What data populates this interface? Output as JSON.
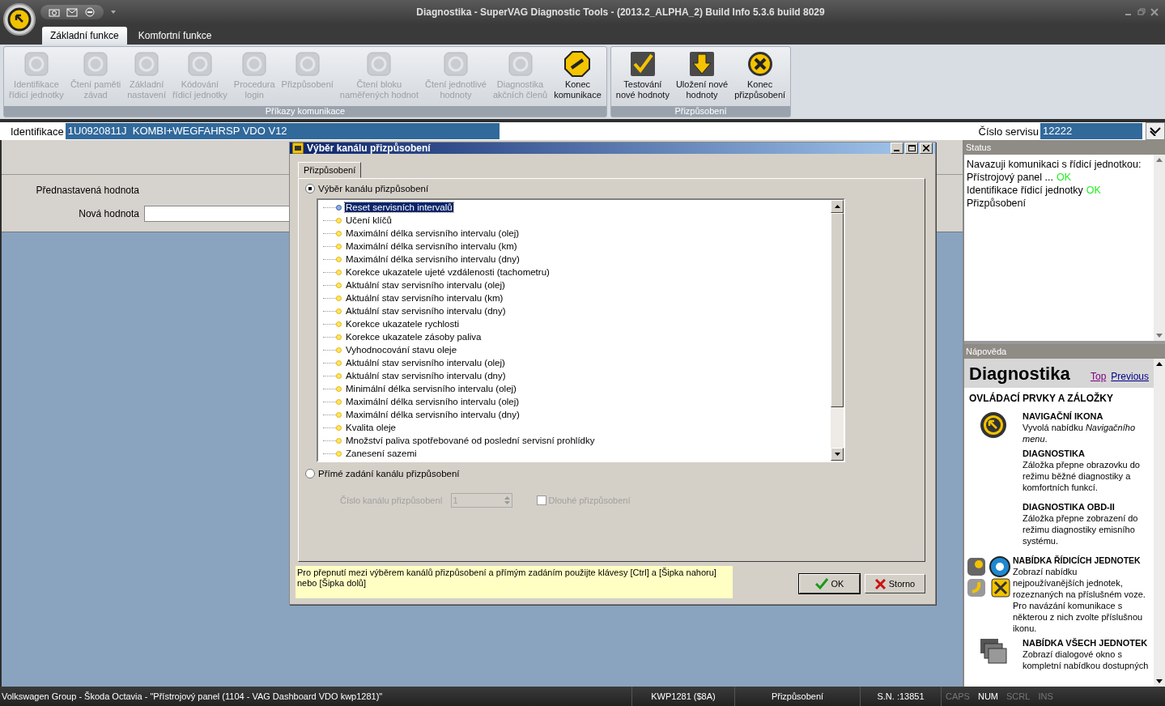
{
  "window": {
    "title": "Diagnostika - SuperVAG Diagnostic Tools -  (2013.2_ALPHA_2) Build Info 5.3.6 build 8029"
  },
  "ribbon_tabs": [
    {
      "label": "Základní funkce",
      "selected": true
    },
    {
      "label": "Komfortní funkce",
      "selected": false
    }
  ],
  "ribbon_groups": [
    {
      "label": "Příkazy komunikace",
      "buttons": [
        {
          "label": "Identifikace\nřídicí jednotky",
          "disabled": true
        },
        {
          "label": "Čtení paměti\nzávad",
          "disabled": true
        },
        {
          "label": "Základní\nnastavení",
          "disabled": true
        },
        {
          "label": "Kódování\nřídicí jednotky",
          "disabled": true
        },
        {
          "label": "Procedura\nlogin",
          "disabled": true
        },
        {
          "label": "Přizpůsobení",
          "disabled": true
        },
        {
          "label": "Čtení bloku\nnaměřených hodnot",
          "disabled": true
        },
        {
          "label": "Čtení jednotlivé\nhodnoty",
          "disabled": true
        },
        {
          "label": "Diagnostika\nakčních členů",
          "disabled": true
        },
        {
          "label": "Konec\nkomunikace",
          "disabled": false
        }
      ]
    },
    {
      "label": "Přizpůsobení",
      "buttons": [
        {
          "label": "Testování\nnové hodnoty",
          "disabled": false
        },
        {
          "label": "Uložení nové\nhodnoty",
          "disabled": false
        },
        {
          "label": "Konec\npřizpůsobení",
          "disabled": false
        }
      ]
    }
  ],
  "info_bar": {
    "fields": [
      {
        "label": "Identifikace",
        "value": "1U0920811J  KOMBI+WEGFAHRSP VDO V12"
      },
      {
        "label": "Číslo servisu",
        "value": "12222"
      }
    ]
  },
  "value_panel": {
    "preset_label": "Přednastavená hodnota",
    "new_label": "Nová hodnota"
  },
  "dialog": {
    "title": "Výběr kanálu přizpůsobení",
    "tab": "Přizpůsobení",
    "list_radio": {
      "label": "Výběr kanálu přizpůsobení",
      "selected": true
    },
    "channels": [
      {
        "label": "Reset servisních intervalů",
        "selected": true
      },
      {
        "label": "Učení klíčů",
        "selected": false
      },
      {
        "label": "Maximální délka servisního intervalu (olej)",
        "selected": false
      },
      {
        "label": "Maximální délka servisního intervalu (km)",
        "selected": false
      },
      {
        "label": "Maximální délka servisního intervalu (dny)",
        "selected": false
      },
      {
        "label": "Korekce ukazatele ujeté vzdálenosti (tachometru)",
        "selected": false
      },
      {
        "label": "Aktuální stav servisního intervalu (olej)",
        "selected": false
      },
      {
        "label": "Aktuální stav servisního intervalu (km)",
        "selected": false
      },
      {
        "label": "Aktuální stav servisního intervalu (dny)",
        "selected": false
      },
      {
        "label": "Korekce ukazatele rychlosti",
        "selected": false
      },
      {
        "label": "Korekce ukazatele zásoby paliva",
        "selected": false
      },
      {
        "label": "Vyhodnocování stavu oleje",
        "selected": false
      },
      {
        "label": "Aktuální stav servisního intervalu (olej)",
        "selected": false
      },
      {
        "label": "Aktuální stav servisního intervalu (dny)",
        "selected": false
      },
      {
        "label": "Minimální délka servisního intervalu (olej)",
        "selected": false
      },
      {
        "label": "Maximální délka servisního intervalu (olej)",
        "selected": false
      },
      {
        "label": "Maximální délka servisního intervalu (dny)",
        "selected": false
      },
      {
        "label": "Kvalita oleje",
        "selected": false
      },
      {
        "label": "Množství paliva spotřebované od poslední servisní prohlídky",
        "selected": false
      },
      {
        "label": "Zanesení sazemi",
        "selected": false
      }
    ],
    "direct_radio": {
      "label": "Přímé zadání kanálu přizpůsobení",
      "selected": false
    },
    "channel_number": {
      "label": "Číslo kanálu přizpůsobení",
      "value": "1",
      "disabled": true
    },
    "long_checkbox": {
      "label": "Dlouhé přizpůsobení",
      "checked": false,
      "disabled": true
    },
    "hint": "Pro přepnutí mezi výběrem kanálů přizpůsobení a přímým zadáním použijte klávesy [Ctrl] a [Šipka nahoru] nebo [Šipka dolů]",
    "buttons": [
      {
        "label": "OK",
        "kind": "ok"
      },
      {
        "label": "Storno",
        "kind": "cancel"
      }
    ]
  },
  "status_panel": {
    "title": "Status",
    "lines": [
      {
        "text": "Navazuji komunikaci s řídicí jednotkou:"
      },
      {
        "text": "Přístrojový panel ...",
        "result": "OK"
      },
      {
        "text": "Identifikace řídicí jednotky",
        "result": "OK"
      },
      {
        "text": "Přizpůsobení"
      }
    ]
  },
  "help_panel": {
    "title": "Nápověda",
    "heading": "Diagnostika",
    "links": [
      {
        "label": "Top",
        "visited": true
      },
      {
        "label": "Previous",
        "visited": false
      }
    ],
    "subtitle": "OVLÁDACÍ PRVKY A ZÁLOŽKY",
    "entries": [
      {
        "title": "NAVIGAČNÍ IKONA",
        "text": "Vyvolá nabídku *Navigačního menu*."
      },
      {
        "title": "DIAGNOSTIKA",
        "text": "Záložka přepne obrazovku do režimu běžné diagnostiky a komfortních funkcí."
      },
      {
        "title": "DIAGNOSTIKA OBD-II",
        "text": "Záložka přepne zobrazení do režimu diagnostiky emisního systému."
      },
      {
        "title": "NABÍDKA ŘÍDICÍCH JEDNOTEK",
        "text": "Zobrazí nabídku nejpoužívanějších jednotek, rozeznaných na příslušném voze. Pro navázání komunikace s některou z nich zvolte příslušnou ikonu."
      },
      {
        "title": "NABÍDKA VŠECH JEDNOTEK",
        "text": "Zobrazí dialogové okno s kompletní nabídkou dostupných"
      }
    ]
  },
  "status_bar": {
    "vehicle": "Volkswagen Group - Škoda Octavia - \"Přístrojový panel (1104 - VAG Dashboard VDO kwp1281)\"",
    "protocol": "KWP1281 ($8A)",
    "mode": "Přizpůsobení",
    "serial": "S.N. :13851",
    "locks": [
      {
        "label": "CAPS",
        "on": false
      },
      {
        "label": "NUM",
        "on": true
      },
      {
        "label": "SCRL",
        "on": false
      },
      {
        "label": "INS",
        "on": false
      }
    ]
  }
}
